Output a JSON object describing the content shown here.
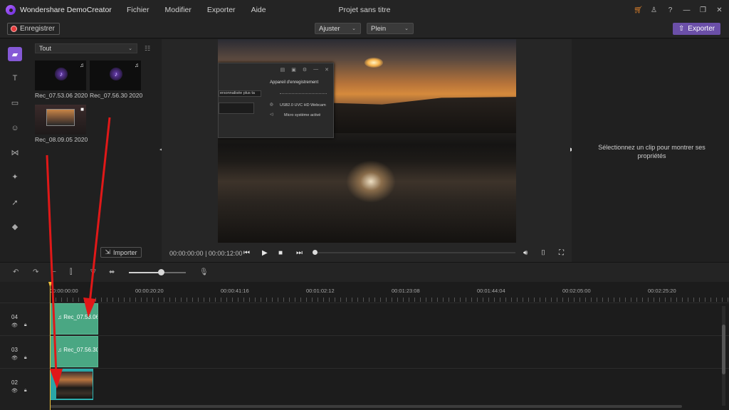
{
  "app": {
    "name": "Wondershare DemoCreator",
    "project_title": "Projet sans titre",
    "menu": [
      "Fichier",
      "Modifier",
      "Exporter",
      "Aide"
    ]
  },
  "toolbar": {
    "record_label": "Enregistrer",
    "fit_label": "Ajuster",
    "quality_label": "Plein",
    "export_label": "Exporter"
  },
  "media": {
    "filter_label": "Tout",
    "items": [
      {
        "label": "Rec_07.53.06 2020...",
        "type": "audio"
      },
      {
        "label": "Rec_07.56.30 2020...",
        "type": "audio"
      },
      {
        "label": "Rec_08.09.05 2020...",
        "type": "video"
      }
    ],
    "import_label": "Importer"
  },
  "preview": {
    "current_time": "00:00:00:00",
    "separator": "|",
    "total_time": "00:00:12:00",
    "recorder": {
      "heading": "Appareil d'enregistrement",
      "field_text": "ersonnalisée plus ta",
      "webcam": "USB2.0 UVC HD Webcam",
      "mic": "Micro système activé"
    }
  },
  "properties": {
    "placeholder": "Sélectionnez un clip pour montrer ses propriétés"
  },
  "timeline": {
    "ruler_labels": [
      "00:00:00:00",
      "00:00:20:20",
      "00:00:41:16",
      "00:01:02:12",
      "00:01:23:08",
      "00:01:44:04",
      "00:02:05:00",
      "00:02:25:20"
    ],
    "tracks": [
      {
        "number": "04",
        "clip_label": "Rec_07.53.06"
      },
      {
        "number": "03",
        "clip_label": "Rec_07.56.30"
      },
      {
        "number": "02",
        "clip_label": ""
      }
    ]
  },
  "colors": {
    "accent": "#8559d6",
    "export": "#6b4fa8",
    "audio_clip": "#4aa783",
    "video_clip": "#2aa6a6",
    "playhead": "#f0c23b",
    "annotation_arrow": "#e01818"
  },
  "icons": {
    "rail": [
      "folder-icon",
      "text-template-icon",
      "annotation-icon",
      "sticker-icon",
      "transition-icon",
      "effects-icon",
      "cursor-effects-icon",
      "color-icon"
    ]
  }
}
